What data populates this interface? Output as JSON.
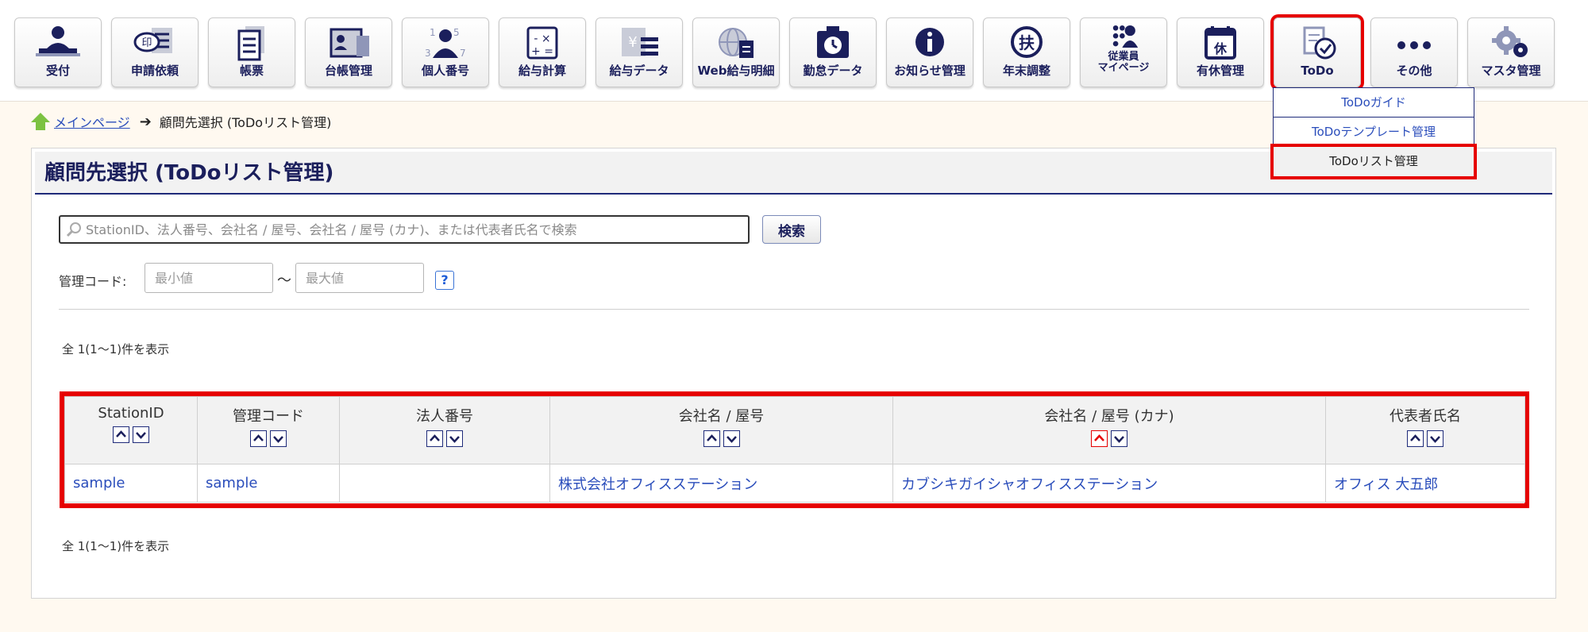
{
  "toolbar": {
    "items": [
      {
        "label": "受付",
        "icon": "reception-icon"
      },
      {
        "label": "申請依頼",
        "icon": "stamp-request-icon"
      },
      {
        "label": "帳票",
        "icon": "form-document-icon"
      },
      {
        "label": "台帳管理",
        "icon": "ledger-card-icon"
      },
      {
        "label": "個人番号",
        "icon": "personal-number-icon"
      },
      {
        "label": "給与計算",
        "icon": "calculator-icon"
      },
      {
        "label": "給与データ",
        "icon": "payroll-data-icon"
      },
      {
        "label": "Web給与明細",
        "icon": "web-payslip-icon"
      },
      {
        "label": "勤怠データ",
        "icon": "attendance-clock-icon"
      },
      {
        "label": "お知らせ管理",
        "icon": "info-icon"
      },
      {
        "label": "年末調整",
        "icon": "year-end-adjustment-icon"
      },
      {
        "label": "従業員\nマイページ",
        "icon": "employee-mypage-icon"
      },
      {
        "label": "有休管理",
        "icon": "paid-leave-calendar-icon"
      },
      {
        "label": "ToDo",
        "icon": "todo-check-icon"
      },
      {
        "label": "その他",
        "icon": "more-dots-icon"
      },
      {
        "label": "マスタ管理",
        "icon": "gear-master-icon"
      }
    ]
  },
  "dropdown": {
    "items": [
      "ToDoガイド",
      "ToDoテンプレート管理",
      "ToDoリスト管理"
    ]
  },
  "breadcrumb": {
    "home": "メインページ",
    "current": "顧問先選択 (ToDoリスト管理)"
  },
  "panel": {
    "title": "顧問先選択 (ToDoリスト管理)",
    "search_placeholder": "StationID、法人番号、会社名 / 屋号、会社名 / 屋号 (カナ)、または代表者氏名で検索",
    "search_button": "検索",
    "code_label": "管理コード:",
    "min_placeholder": "最小値",
    "max_placeholder": "最大値",
    "tilde": "～",
    "help": "?",
    "count_text": "全 1(1～1)件を表示"
  },
  "table": {
    "headers": [
      "StationID",
      "管理コード",
      "法人番号",
      "会社名 / 屋号",
      "会社名 / 屋号 (カナ)",
      "代表者氏名"
    ],
    "rows": [
      [
        "sample",
        "sample",
        "",
        "株式会社オフィスステーション",
        "カブシキガイシャオフィスステーション",
        "オフィス 大五郎"
      ]
    ]
  },
  "colors": {
    "navy": "#1b1f5c",
    "link": "#2a4dbb",
    "highlight": "#e60000",
    "background": "#fff9f0"
  }
}
